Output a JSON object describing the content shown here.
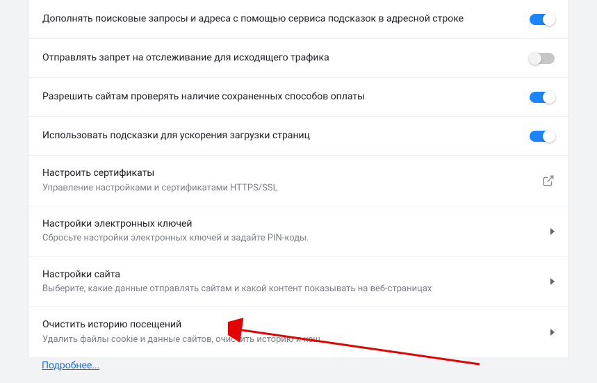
{
  "settings": [
    {
      "title": "Дополнять поисковые запросы и адреса с помощью сервиса подсказок в адресной строке",
      "sub": "",
      "control": "toggle",
      "state": "on"
    },
    {
      "title": "Отправлять запрет на отслеживание для исходящего трафика",
      "sub": "",
      "control": "toggle",
      "state": "off"
    },
    {
      "title": "Разрешить сайтам проверять наличие сохраненных способов оплаты",
      "sub": "",
      "control": "toggle",
      "state": "on"
    },
    {
      "title": "Использовать подсказки для ускорения загрузки страниц",
      "sub": "",
      "control": "toggle",
      "state": "on"
    },
    {
      "title": "Настроить сертификаты",
      "sub": "Управление настройками и сертификатами HTTPS/SSL",
      "control": "external"
    },
    {
      "title": "Настройки электронных ключей",
      "sub": "Сбросьте настройки электронных ключей и задайте PIN-коды.",
      "control": "chevron"
    },
    {
      "title": "Настройки сайта",
      "sub": "Выберите, какие данные отправлять сайтам и какой контент показывать на веб-страницах",
      "control": "chevron"
    },
    {
      "title": "Очистить историю посещений",
      "sub": "Удалить файлы cookie и данные сайтов, очистить историю и кеш",
      "control": "chevron"
    }
  ],
  "learn_more": "Подробнее..."
}
